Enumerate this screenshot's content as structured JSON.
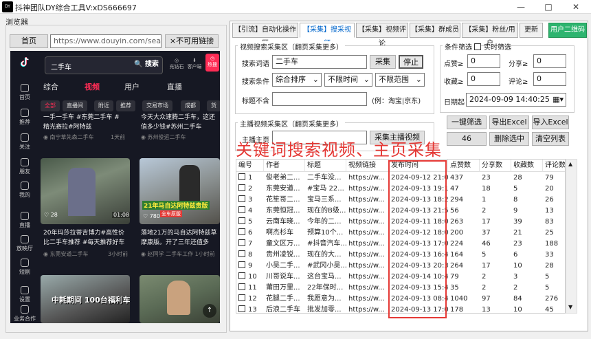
{
  "window": {
    "title": "抖神团队DY综合工具V:xDS666697",
    "icon": "DY"
  },
  "browser": {
    "group_label": "浏览器",
    "home_button": "首页",
    "url": "https://www.douyin.com/search/%E4",
    "no_link_button": "×不可用链接"
  },
  "douyin": {
    "search_query": "二手车",
    "search_button": "搜索",
    "header_icons": [
      "充钻石",
      "客户端",
      "热搜"
    ],
    "sidebar": [
      {
        "label": "首页",
        "icon": "home-icon"
      },
      {
        "label": "推荐",
        "icon": "recommend-icon"
      },
      {
        "label": "关注",
        "icon": "follow-icon"
      },
      {
        "label": "朋友",
        "icon": "friends-icon"
      },
      {
        "label": "我的",
        "icon": "me-icon"
      },
      {
        "label": "直播",
        "icon": "live-icon"
      },
      {
        "label": "放映厅",
        "icon": "theater-icon"
      },
      {
        "label": "短剧",
        "icon": "drama-icon"
      },
      {
        "label": "设置",
        "icon": "settings-icon"
      },
      {
        "label": "业务合作",
        "icon": "business-icon"
      }
    ],
    "tabs": [
      "综合",
      "视频",
      "用户",
      "直播"
    ],
    "active_tab": "视频",
    "chips": [
      "全部",
      "直播间",
      "附近",
      "推荐",
      "交易市场",
      "成都",
      "货"
    ],
    "cards": [
      {
        "title": "一手一手车 #东莞二手车 #精光赛拉#阿特兹",
        "meta": "南宁草先森二手车",
        "age": "1天前",
        "likes": "",
        "duration": ""
      },
      {
        "title": "今天大众速腾二手车，这还值多少钱#苏州二手车",
        "meta": "苏州俊运二手车",
        "age": "",
        "likes": "",
        "duration": ""
      },
      {
        "title": "20年玛莎拉蒂吉博力#高性价比二手车推荐 #每天推荐好车",
        "meta": "东莞安道二手车",
        "age": "3小时前",
        "likes": "28",
        "duration": "01:08"
      },
      {
        "title": "落地21万的马自达阿特兹草摩康版。开了三年还值多",
        "meta": "赵同学 二手车工作",
        "age": "1小时前",
        "likes": "780",
        "duration": ""
      },
      {
        "title": "中耗期间 100台福利车型",
        "meta": "",
        "age": "",
        "likes": "",
        "duration": ""
      },
      {
        "title": "",
        "meta": "",
        "age": "",
        "likes": "",
        "duration": ""
      }
    ],
    "card2_overlay": "21年马自达阿特兹贵版",
    "card2_sub": "全车原版"
  },
  "tabs": [
    "【引流】自动化操作区",
    "【采集】搜采视频",
    "【采集】视频评论",
    "【采集】群成员",
    "【采集】粉丝/用户",
    "更新",
    "用户二维码"
  ],
  "active_tab": "【采集】搜采视频",
  "search_area": {
    "legend": "视频搜索采集区（翻页采集更多）",
    "keyword_label": "搜索词语",
    "keyword_value": "二手车",
    "collect_button": "采集",
    "stop_button": "停止",
    "conditions_label": "搜索条件",
    "sort_value": "综合排序",
    "time_value": "不限时间",
    "range_value": "不限范围",
    "exclude_label": "标题不含",
    "exclude_value": "",
    "exclude_hint": "(例：淘宝|京东)"
  },
  "home_area": {
    "legend": "主播视频采集区（翻页采集更多）",
    "home_label": "主播主页",
    "home_value": "",
    "collect_button": "采集主播视频"
  },
  "filter": {
    "legend": "条件筛选",
    "realtime_label": "实时筛选",
    "likes_label": "点赞≥",
    "likes_value": "0",
    "shares_label": "分享≥",
    "shares_value": "0",
    "favs_label": "收藏≥",
    "favs_value": "0",
    "comments_label": "评论≥",
    "comments_value": "0",
    "date_label": "日期起",
    "date_value": "2024-09-09 14:40:25",
    "buttons": [
      "一键筛选",
      "导出Excel",
      "导入Excel",
      "46",
      "删除选中",
      "清空列表"
    ]
  },
  "overlay_title": "关键词搜索视频、主页采集",
  "table": {
    "headers": [
      "编号",
      "作者",
      "标题",
      "视频链接",
      "发布时间",
      "点赞数",
      "分享数",
      "收藏数",
      "评论数"
    ],
    "rows": [
      [
        "1",
        "俊老弟二...",
        "二手车没...",
        "https://w...",
        "2024-09-12 21:0...",
        "437",
        "23",
        "28",
        "79"
      ],
      [
        "2",
        "东莞安道...",
        "#宝马 22...",
        "https://w...",
        "2024-09-13 19:1...",
        "47",
        "18",
        "5",
        "20"
      ],
      [
        "3",
        "花笙哥二...",
        "宝马三系...",
        "https://w...",
        "2024-09-13 18:2...",
        "294",
        "1",
        "8",
        "26"
      ],
      [
        "4",
        "东莞恒冠...",
        "现在的B级...",
        "https://w...",
        "2024-09-13 21:5...",
        "56",
        "2",
        "9",
        "13"
      ],
      [
        "5",
        "云南车晓...",
        "今年的二...",
        "https://w...",
        "2024-09-11 18:0...",
        "263",
        "17",
        "39",
        "83"
      ],
      [
        "6",
        "啊杰杉车",
        "预算10个...",
        "https://w...",
        "2024-09-12 18:0...",
        "200",
        "37",
        "21",
        "25"
      ],
      [
        "7",
        "童文区万...",
        "#抖音汽车...",
        "https://w...",
        "2024-09-13 17:0...",
        "224",
        "46",
        "23",
        "188"
      ],
      [
        "8",
        "贵州凌锐...",
        "现在的大...",
        "https://w...",
        "2024-09-13 16:4...",
        "164",
        "5",
        "6",
        "33"
      ],
      [
        "9",
        "小吴二手...",
        "#武冈小吴...",
        "https://w...",
        "2024-09-13 20:3...",
        "264",
        "17",
        "10",
        "28"
      ],
      [
        "10",
        "川哥说车...",
        "这台宝马...",
        "https://w...",
        "2024-09-14 10:4...",
        "79",
        "2",
        "3",
        "5"
      ],
      [
        "11",
        "莆田万里...",
        "22年保时...",
        "https://w...",
        "2024-09-13 15:4...",
        "35",
        "2",
        "2",
        "5"
      ],
      [
        "12",
        "花腿二手...",
        "我愿意为...",
        "https://w...",
        "2024-09-13 08:4...",
        "1040",
        "97",
        "84",
        "276"
      ],
      [
        "13",
        "后浪二手车",
        "批发加零...",
        "https://w...",
        "2024-09-13 17:0...",
        "178",
        "13",
        "10",
        "45"
      ]
    ]
  },
  "colors": {
    "accent_red": "#e53935",
    "brand_green": "#2db46f",
    "douyin_bg": "#161823",
    "douyin_pink": "#fe2c55",
    "link_blue": "#0066cc"
  }
}
